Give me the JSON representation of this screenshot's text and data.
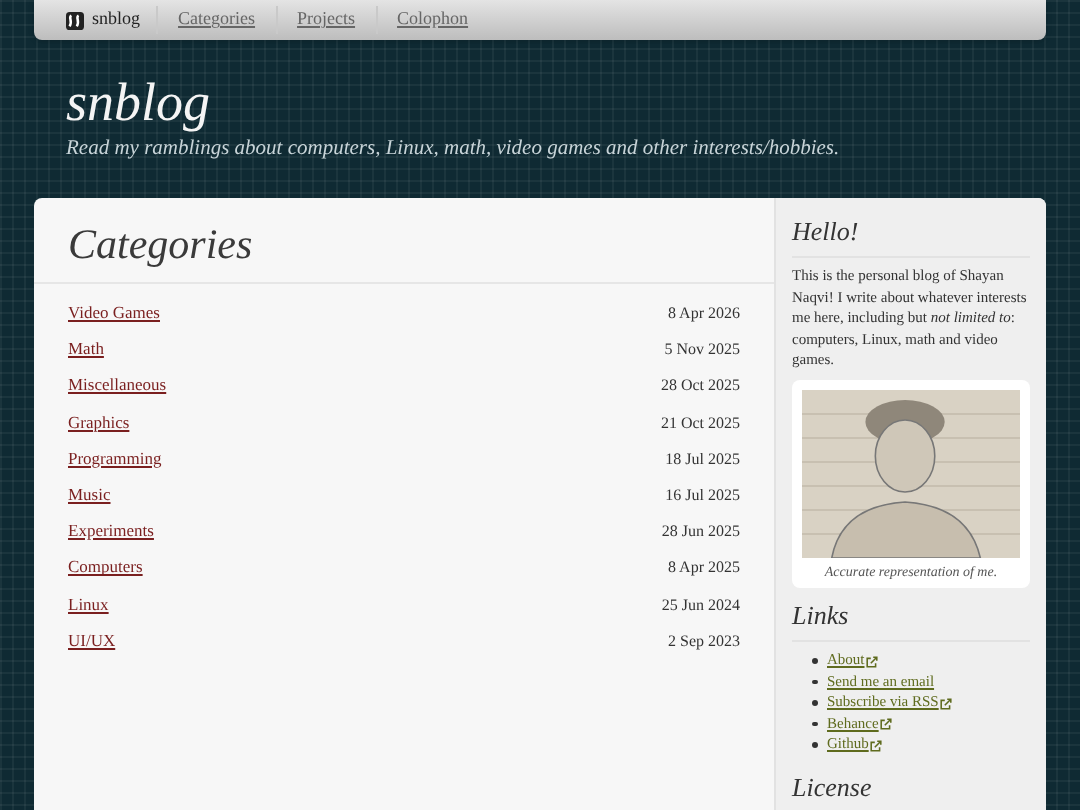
{
  "navbar": {
    "brand": "snblog",
    "items": [
      {
        "label": "Categories"
      },
      {
        "label": "Projects"
      },
      {
        "label": "Colophon"
      }
    ]
  },
  "header": {
    "title": "snblog",
    "tagline": "Read my ramblings about computers, Linux, math, video games and other interests/hobbies."
  },
  "main": {
    "heading": "Categories",
    "rows": [
      {
        "name": "Video Games",
        "date": "8 Apr 2026"
      },
      {
        "name": "Math",
        "date": "5 Nov 2025"
      },
      {
        "name": "Miscellaneous",
        "date": "28 Oct 2025"
      },
      {
        "name": "Graphics",
        "date": "21 Oct 2025"
      },
      {
        "name": "Programming",
        "date": "18 Jul 2025"
      },
      {
        "name": "Music",
        "date": "16 Jul 2025"
      },
      {
        "name": "Experiments",
        "date": "28 Jun 2025"
      },
      {
        "name": "Computers",
        "date": "8 Apr 2025"
      },
      {
        "name": "Linux",
        "date": "25 Jun 2024"
      },
      {
        "name": "UI/UX",
        "date": "2 Sep 2023"
      }
    ]
  },
  "sidebar": {
    "hello": {
      "heading": "Hello!",
      "text": "This is the personal blog of Shayan Naqvi! I write about whatever interests me here, including but *not limited to*: computers, Linux, math and video games.",
      "figure": {
        "kind": "picture",
        "caption": "Accurate representation of me."
      }
    },
    "links": {
      "heading": "Links",
      "items": [
        {
          "label": "About",
          "external": true
        },
        {
          "label": "Send me an email",
          "external": false
        },
        {
          "label": "Subscribe via RSS",
          "external": true
        },
        {
          "label": "Behance",
          "external": true
        },
        {
          "label": "Github",
          "external": true
        }
      ]
    },
    "license": {
      "heading": "License"
    }
  }
}
